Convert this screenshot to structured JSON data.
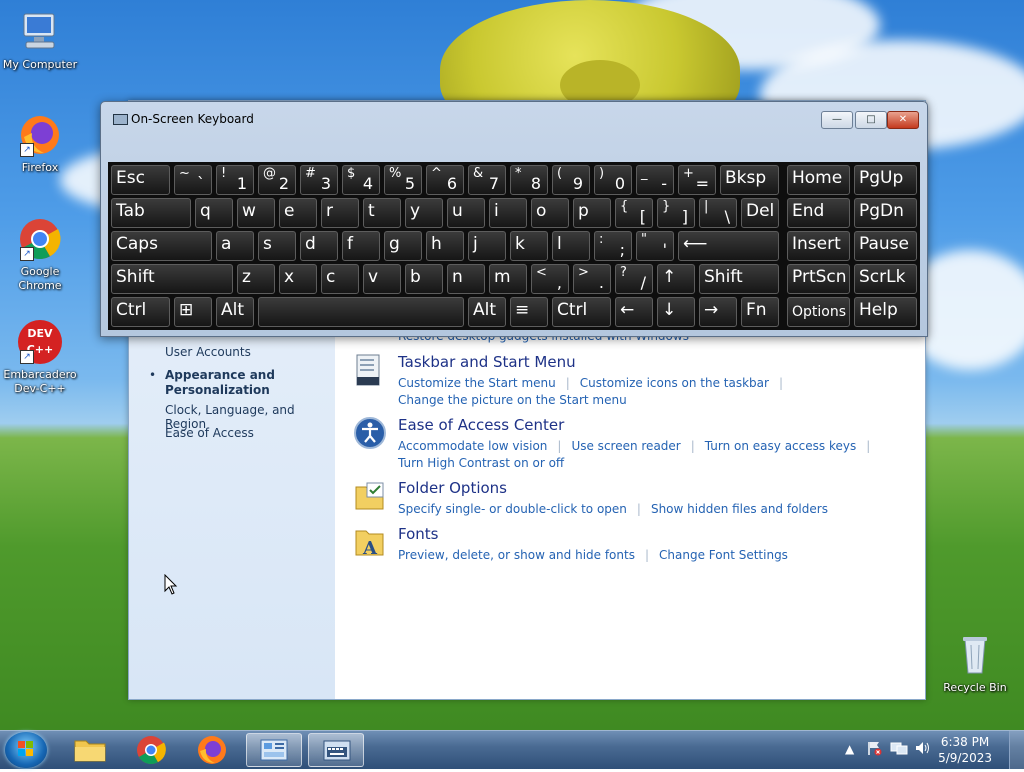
{
  "desktop": {
    "icons": [
      {
        "label": "My Computer",
        "icon": "computer-icon"
      },
      {
        "label": "Firefox",
        "icon": "firefox-icon"
      },
      {
        "label": "Google Chrome",
        "icon": "chrome-icon"
      },
      {
        "label": "Embarcadero Dev-C++",
        "icon": "devcpp-icon",
        "badge": "DEV C++"
      },
      {
        "label": "Recycle Bin",
        "icon": "recycle-bin-icon"
      }
    ]
  },
  "control_panel": {
    "nav": [
      {
        "label": "User Accounts",
        "active": false
      },
      {
        "label": "Appearance and Personalization",
        "active": true
      },
      {
        "label": "Clock, Language, and Region",
        "active": false
      },
      {
        "label": "Ease of Access",
        "active": false
      }
    ],
    "partial_link": "Restore desktop gadgets installed with Windows",
    "categories": [
      {
        "title": "Taskbar and Start Menu",
        "links": [
          "Customize the Start menu",
          "Customize icons on the taskbar",
          "Change the picture on the Start menu"
        ]
      },
      {
        "title": "Ease of Access Center",
        "links": [
          "Accommodate low vision",
          "Use screen reader",
          "Turn on easy access keys",
          "Turn High Contrast on or off"
        ]
      },
      {
        "title": "Folder Options",
        "links": [
          "Specify single- or double-click to open",
          "Show hidden files and folders"
        ]
      },
      {
        "title": "Fonts",
        "links": [
          "Preview, delete, or show and hide fonts",
          "Change Font Settings"
        ]
      }
    ]
  },
  "osk": {
    "title": "On-Screen Keyboard",
    "buttons": {
      "minimize": "—",
      "restore": "□",
      "close": "✕"
    },
    "rows": [
      [
        {
          "label": "Esc"
        },
        {
          "top": "~",
          "bottom": "`"
        },
        {
          "top": "!",
          "bottom": "1"
        },
        {
          "top": "@",
          "bottom": "2"
        },
        {
          "top": "#",
          "bottom": "3"
        },
        {
          "top": "$",
          "bottom": "4"
        },
        {
          "top": "%",
          "bottom": "5"
        },
        {
          "top": "^",
          "bottom": "6"
        },
        {
          "top": "&",
          "bottom": "7"
        },
        {
          "top": "*",
          "bottom": "8"
        },
        {
          "top": "(",
          "bottom": "9"
        },
        {
          "top": ")",
          "bottom": "0"
        },
        {
          "top": "_",
          "bottom": "-"
        },
        {
          "top": "+",
          "bottom": "="
        },
        {
          "label": "Bksp"
        },
        {
          "label": "Home"
        },
        {
          "label": "PgUp"
        }
      ],
      [
        {
          "label": "Tab"
        },
        {
          "label": "q"
        },
        {
          "label": "w"
        },
        {
          "label": "e"
        },
        {
          "label": "r"
        },
        {
          "label": "t"
        },
        {
          "label": "y"
        },
        {
          "label": "u"
        },
        {
          "label": "i"
        },
        {
          "label": "o"
        },
        {
          "label": "p"
        },
        {
          "top": "{",
          "bottom": "["
        },
        {
          "top": "}",
          "bottom": "]"
        },
        {
          "top": "|",
          "bottom": "\\"
        },
        {
          "label": "Del"
        },
        {
          "label": "End"
        },
        {
          "label": "PgDn"
        }
      ],
      [
        {
          "label": "Caps"
        },
        {
          "label": "a"
        },
        {
          "label": "s"
        },
        {
          "label": "d"
        },
        {
          "label": "f"
        },
        {
          "label": "g"
        },
        {
          "label": "h"
        },
        {
          "label": "j"
        },
        {
          "label": "k"
        },
        {
          "label": "l"
        },
        {
          "top": ":",
          "bottom": ";"
        },
        {
          "top": "\"",
          "bottom": "'"
        },
        {
          "label": "⟵"
        },
        {
          "label": "Insert"
        },
        {
          "label": "Pause"
        }
      ],
      [
        {
          "label": "Shift"
        },
        {
          "label": "z"
        },
        {
          "label": "x"
        },
        {
          "label": "c"
        },
        {
          "label": "v"
        },
        {
          "label": "b"
        },
        {
          "label": "n"
        },
        {
          "label": "m"
        },
        {
          "top": "<",
          "bottom": ","
        },
        {
          "top": ">",
          "bottom": "."
        },
        {
          "top": "?",
          "bottom": "/"
        },
        {
          "label": "↑"
        },
        {
          "label": "Shift"
        },
        {
          "label": "PrtScn"
        },
        {
          "label": "ScrLk"
        }
      ],
      [
        {
          "label": "Ctrl"
        },
        {
          "label": "⊞"
        },
        {
          "label": "Alt"
        },
        {
          "label": ""
        },
        {
          "label": "Alt"
        },
        {
          "label": "≡"
        },
        {
          "label": "Ctrl"
        },
        {
          "label": "←"
        },
        {
          "label": "↓"
        },
        {
          "label": "→"
        },
        {
          "label": "Fn"
        },
        {
          "label": "Options"
        },
        {
          "label": "Help"
        }
      ]
    ]
  },
  "taskbar": {
    "apps": [
      {
        "name": "file-explorer-icon",
        "active": false
      },
      {
        "name": "chrome-icon",
        "active": false
      },
      {
        "name": "firefox-icon",
        "active": false
      },
      {
        "name": "control-panel-icon",
        "active": true
      },
      {
        "name": "on-screen-keyboard-icon",
        "active": true
      }
    ],
    "clock": {
      "time": "6:38 PM",
      "date": "5/9/2023"
    }
  }
}
